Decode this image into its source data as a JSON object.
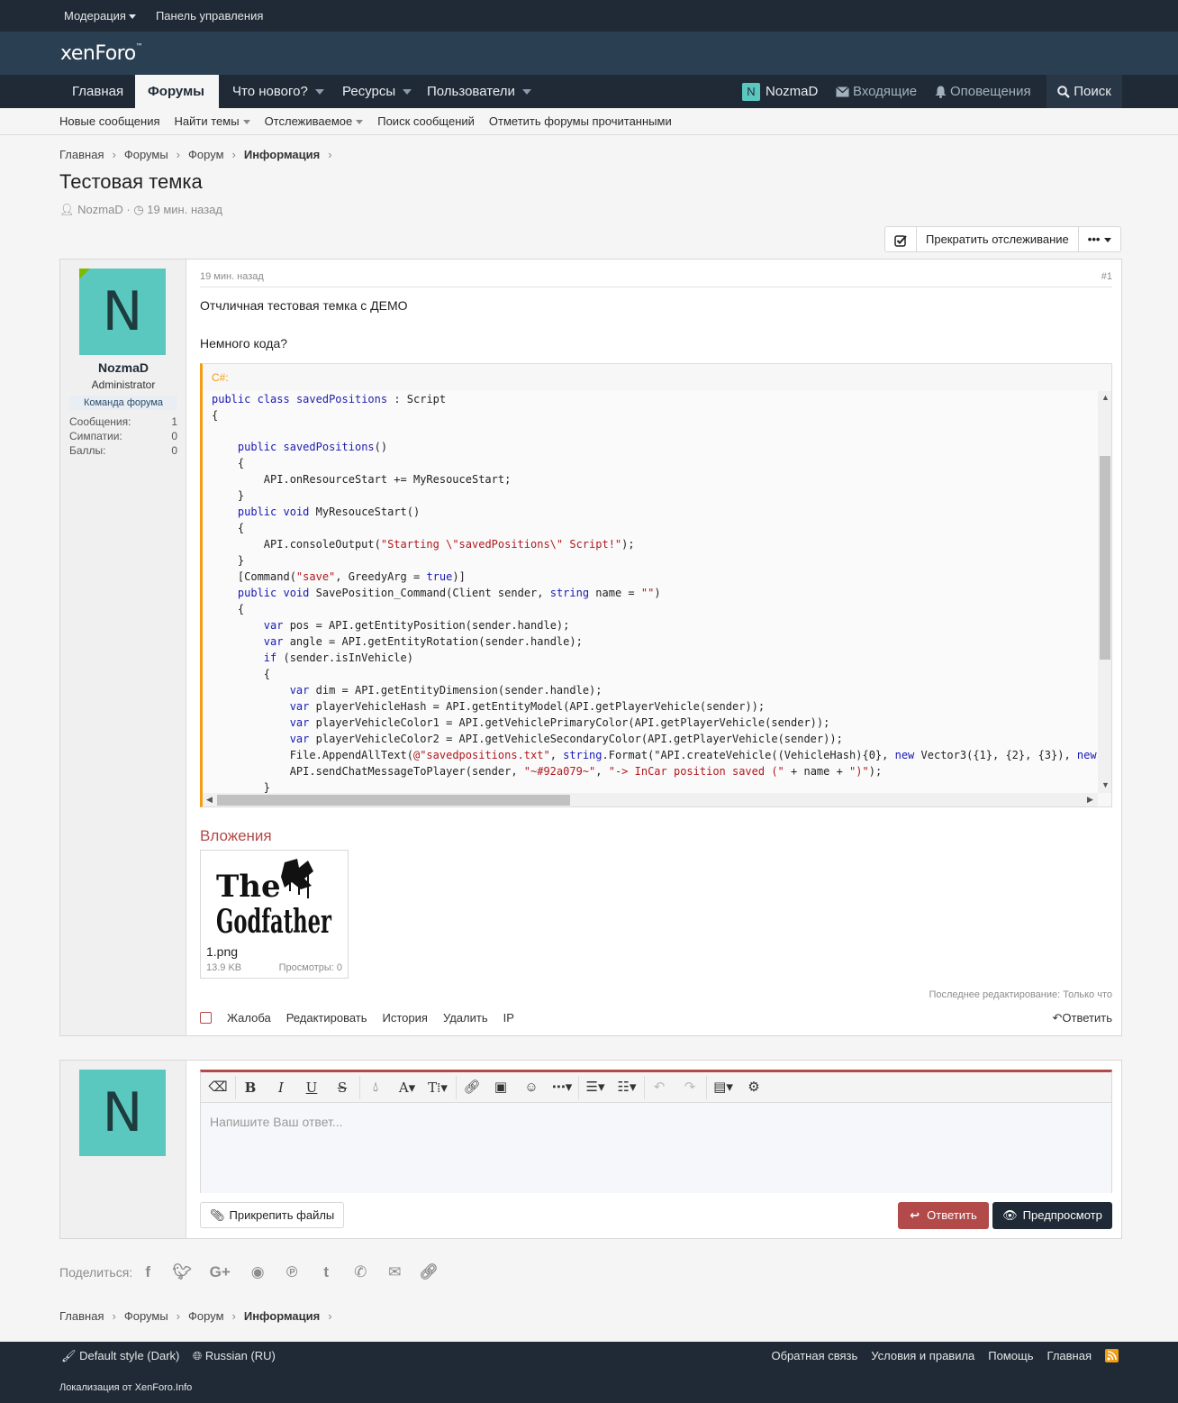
{
  "staff_bar": {
    "moderation": "Модерация",
    "admin_panel": "Панель управления"
  },
  "logo": {
    "text": "xenForo",
    "mark": "™"
  },
  "nav": {
    "tabs": [
      {
        "label": "Главная"
      },
      {
        "label": "Форумы"
      },
      {
        "label": "Что нового?"
      },
      {
        "label": "Ресурсы"
      },
      {
        "label": "Пользователи"
      }
    ],
    "user_initial": "N",
    "username": "NozmaD",
    "inbox": "Входящие",
    "alerts": "Оповещения",
    "search": "Поиск"
  },
  "subnav": {
    "new_posts": "Новые сообщения",
    "find_threads": "Найти темы",
    "watched": "Отслеживаемое",
    "search_posts": "Поиск сообщений",
    "mark_read": "Отметить форумы прочитанными"
  },
  "breadcrumbs": [
    "Главная",
    "Форумы",
    "Форум",
    "Информация"
  ],
  "thread": {
    "title": "Тестовая темка",
    "author": "NozmaD",
    "time": "19 мин. назад",
    "unwatch": "Прекратить отслеживание",
    "more": "•••"
  },
  "post": {
    "user": {
      "initial": "N",
      "name": "NozmaD",
      "title": "Administrator",
      "banner": "Команда форума",
      "stats": [
        {
          "label": "Сообщения:",
          "value": "1"
        },
        {
          "label": "Симпатии:",
          "value": "0"
        },
        {
          "label": "Баллы:",
          "value": "0"
        }
      ]
    },
    "date": "19 мин. назад",
    "number": "#1",
    "text1": "Отчличная тестовая темка с ДЕМО",
    "text2": "Немного кода?",
    "code_lang": "C#:",
    "code_lines": [
      "public class savedPositions : Script",
      "{",
      "",
      "    public savedPositions()",
      "    {",
      "        API.onResourceStart += MyResouceStart;",
      "    }",
      "    public void MyResouceStart()",
      "    {",
      "        API.consoleOutput(\"Starting \\\"savedPositions\\\" Script!\");",
      "    }",
      "    [Command(\"save\", GreedyArg = true)]",
      "    public void SavePosition_Command(Client sender, string name = \"\")",
      "    {",
      "        var pos = API.getEntityPosition(sender.handle);",
      "        var angle = API.getEntityRotation(sender.handle);",
      "        if (sender.isInVehicle)",
      "        {",
      "            var dim = API.getEntityDimension(sender.handle);",
      "            var playerVehicleHash = API.getEntityModel(API.getPlayerVehicle(sender));",
      "            var playerVehicleColor1 = API.getVehiclePrimaryColor(API.getPlayerVehicle(sender));",
      "            var playerVehicleColor2 = API.getVehicleSecondaryColor(API.getPlayerVehicle(sender));",
      "            File.AppendAllText(@\"savedpositions.txt\", string.Format(\"API.createVehicle((VehicleHash){0}, new Vector3({1}, {2}, {3}), new V",
      "            API.sendChatMessageToPlayer(sender, \"~#92a079~\", \"-> InCar position saved (\" + name + \")\");",
      "        }"
    ],
    "attachments_heading": "Вложения",
    "attachment": {
      "name": "1.png",
      "size": "13.9 KB",
      "views": "Просмотры: 0",
      "image_text": "The Godfather"
    },
    "last_edit": "Последнее редактирование: Только что",
    "actions": [
      "Жалоба",
      "Редактировать",
      "История",
      "Удалить",
      "IP"
    ],
    "reply": "Ответить"
  },
  "reply_box": {
    "initial": "N",
    "placeholder": "Напишите Ваш ответ...",
    "attach_files": "Прикрепить файлы",
    "reply": "Ответить",
    "preview": "Предпросмотр"
  },
  "share": {
    "label": "Поделиться:",
    "icons": [
      "facebook-icon",
      "twitter-icon",
      "google-plus-icon",
      "reddit-icon",
      "pinterest-icon",
      "tumblr-icon",
      "whatsapp-icon",
      "email-icon",
      "link-icon"
    ]
  },
  "footer": {
    "style": "Default style (Dark)",
    "language": "Russian (RU)",
    "links": [
      "Обратная связь",
      "Условия и правила",
      "Помощь",
      "Главная"
    ],
    "localization_prefix": "Локализация",
    "localization_by": "от",
    "localization_site": "XenForo.Info",
    "rss_color": "#f29d12"
  }
}
